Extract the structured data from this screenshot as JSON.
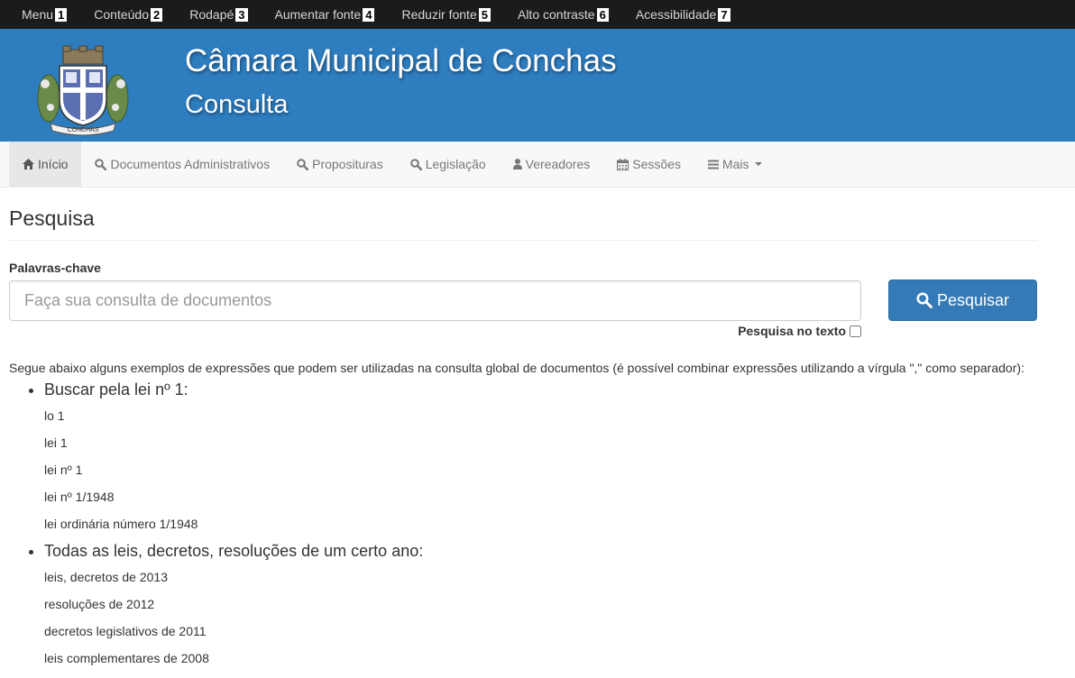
{
  "accessibility_bar": [
    {
      "label": "Menu",
      "key": "1"
    },
    {
      "label": "Conteúdo",
      "key": "2"
    },
    {
      "label": "Rodapé",
      "key": "3"
    },
    {
      "label": "Aumentar fonte",
      "key": "4"
    },
    {
      "label": "Reduzir fonte",
      "key": "5"
    },
    {
      "label": "Alto contraste",
      "key": "6"
    },
    {
      "label": "Acessibilidade",
      "key": "7"
    }
  ],
  "header": {
    "title": "Câmara Municipal de Conchas",
    "subtitle": "Consulta",
    "logo_text": "CONCHAS"
  },
  "nav": [
    {
      "label": "Início",
      "icon": "home-icon"
    },
    {
      "label": "Documentos Administrativos",
      "icon": "search-icon"
    },
    {
      "label": "Proposituras",
      "icon": "search-icon"
    },
    {
      "label": "Legislação",
      "icon": "search-icon"
    },
    {
      "label": "Vereadores",
      "icon": "user-icon"
    },
    {
      "label": "Sessões",
      "icon": "calendar-icon"
    },
    {
      "label": "Mais",
      "icon": "menu-icon"
    }
  ],
  "page": {
    "title": "Pesquisa",
    "keywords_label": "Palavras-chave",
    "search_placeholder": "Faça sua consulta de documentos",
    "search_button": "Pesquisar",
    "search_in_text_label": "Pesquisa no texto",
    "intro": "Segue abaixo alguns exemplos de expressões que podem ser utilizadas na consulta global de documentos (é possível combinar expressões utilizando a vírgula \",\" como separador):"
  },
  "examples": [
    {
      "heading": "Buscar pela lei nº 1:",
      "items": [
        "lo 1",
        "lei 1",
        "lei nº 1",
        "lei nº 1/1948",
        "lei ordinária número 1/1948"
      ]
    },
    {
      "heading": "Todas as leis, decretos, resoluções de um certo ano:",
      "items": [
        "leis, decretos de 2013",
        "resoluções de 2012",
        "decretos legislativos de 2011",
        "leis complementares de 2008"
      ]
    }
  ],
  "colors": {
    "accent": "#2e7dbf",
    "button": "#337ab7",
    "top_bar": "#1b1b1b"
  }
}
